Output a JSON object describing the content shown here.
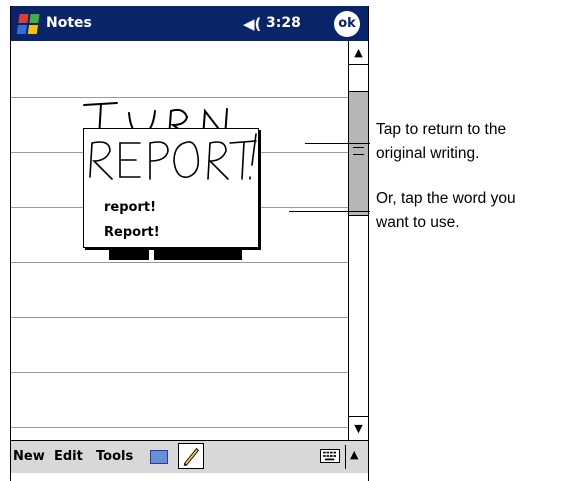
{
  "title_bar": {
    "app_title": "Notes",
    "speaker_icon": "speaker-icon",
    "time": "3:28",
    "ok_label": "ok"
  },
  "note": {
    "handwritten_partial": "TURN",
    "ruled_lines": 7
  },
  "popup": {
    "handwriting": "REPORT!",
    "candidates": [
      "report!",
      "Report!"
    ]
  },
  "menu_bar": {
    "items": [
      "New",
      "Edit",
      "Tools"
    ],
    "icons": [
      "input-panel-icon",
      "pen-icon",
      "keyboard-icon",
      "up-arrow-icon"
    ]
  },
  "callouts": [
    {
      "line1": "Tap to return to the",
      "line2": "original writing."
    },
    {
      "line1": "Or, tap the word you",
      "line2": "want to use."
    }
  ],
  "colors": {
    "title_bar": "#0a246a",
    "menu_bar": "#d8d8d8",
    "scroll_thumb": "#b6b6b6"
  }
}
